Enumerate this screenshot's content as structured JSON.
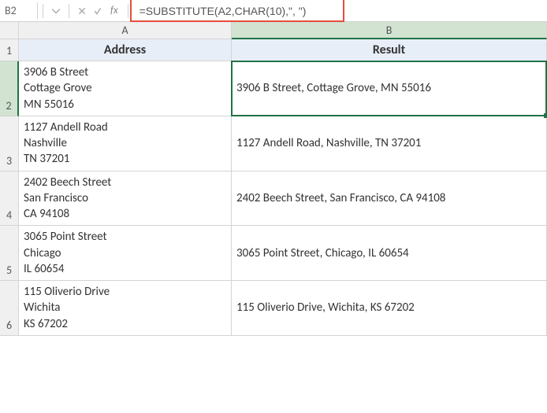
{
  "formula_bar": {
    "name_box": "B2",
    "formula": "=SUBSTITUTE(A2,CHAR(10),\", \")",
    "fx": "fx"
  },
  "columns": [
    "A",
    "B"
  ],
  "headers": {
    "col_a": "Address",
    "col_b": "Result"
  },
  "rows": [
    {
      "num": "1"
    },
    {
      "num": "2",
      "a": "3906 B Street\nCottage Grove\nMN 55016",
      "b": "3906 B Street, Cottage Grove, MN 55016"
    },
    {
      "num": "3",
      "a": "1127 Andell Road\nNashville\nTN 37201",
      "b": "1127 Andell Road, Nashville, TN 37201"
    },
    {
      "num": "4",
      "a": "2402 Beech Street\nSan Francisco\nCA 94108",
      "b": "2402 Beech Street, San Francisco, CA 94108"
    },
    {
      "num": "5",
      "a": "3065 Point Street\nChicago\nIL 60654",
      "b": "3065 Point Street, Chicago, IL 60654"
    },
    {
      "num": "6",
      "a": "115 Oliverio Drive\nWichita\nKS 67202",
      "b": "115 Oliverio Drive, Wichita, KS 67202"
    }
  ],
  "selected_cell": "B2"
}
